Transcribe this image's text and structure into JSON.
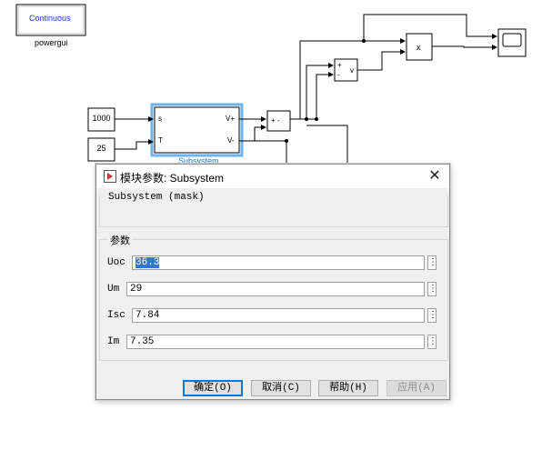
{
  "diagram": {
    "powergui": {
      "block_text": "Continuous",
      "label": "powergui"
    },
    "constants": [
      {
        "value": "1000"
      },
      {
        "value": "25"
      }
    ],
    "subsystem": {
      "caption": "Subsystem",
      "in_ports": [
        "s",
        "T"
      ],
      "out_ports": [
        "V+",
        "V-"
      ]
    },
    "sum_block": {
      "signs": "+ -"
    },
    "product_block": {
      "symbol": "x"
    },
    "voltage_block": {
      "label": "v",
      "signs": [
        "+",
        "-"
      ]
    }
  },
  "dialog": {
    "title": "模块参数: Subsystem",
    "mask_description": "Subsystem (mask)",
    "params_legend": "参数",
    "params": [
      {
        "label": "Uoc",
        "value": "36.3"
      },
      {
        "label": "Um",
        "value": "29"
      },
      {
        "label": "Isc",
        "value": "7.84"
      },
      {
        "label": "Im",
        "value": "7.35"
      }
    ],
    "param_menu_glyph": "⋮",
    "close_glyph": "✕",
    "buttons": {
      "ok": "确定(O)",
      "cancel": "取消(C)",
      "help": "帮助(H)",
      "apply": "应用(A)"
    }
  }
}
